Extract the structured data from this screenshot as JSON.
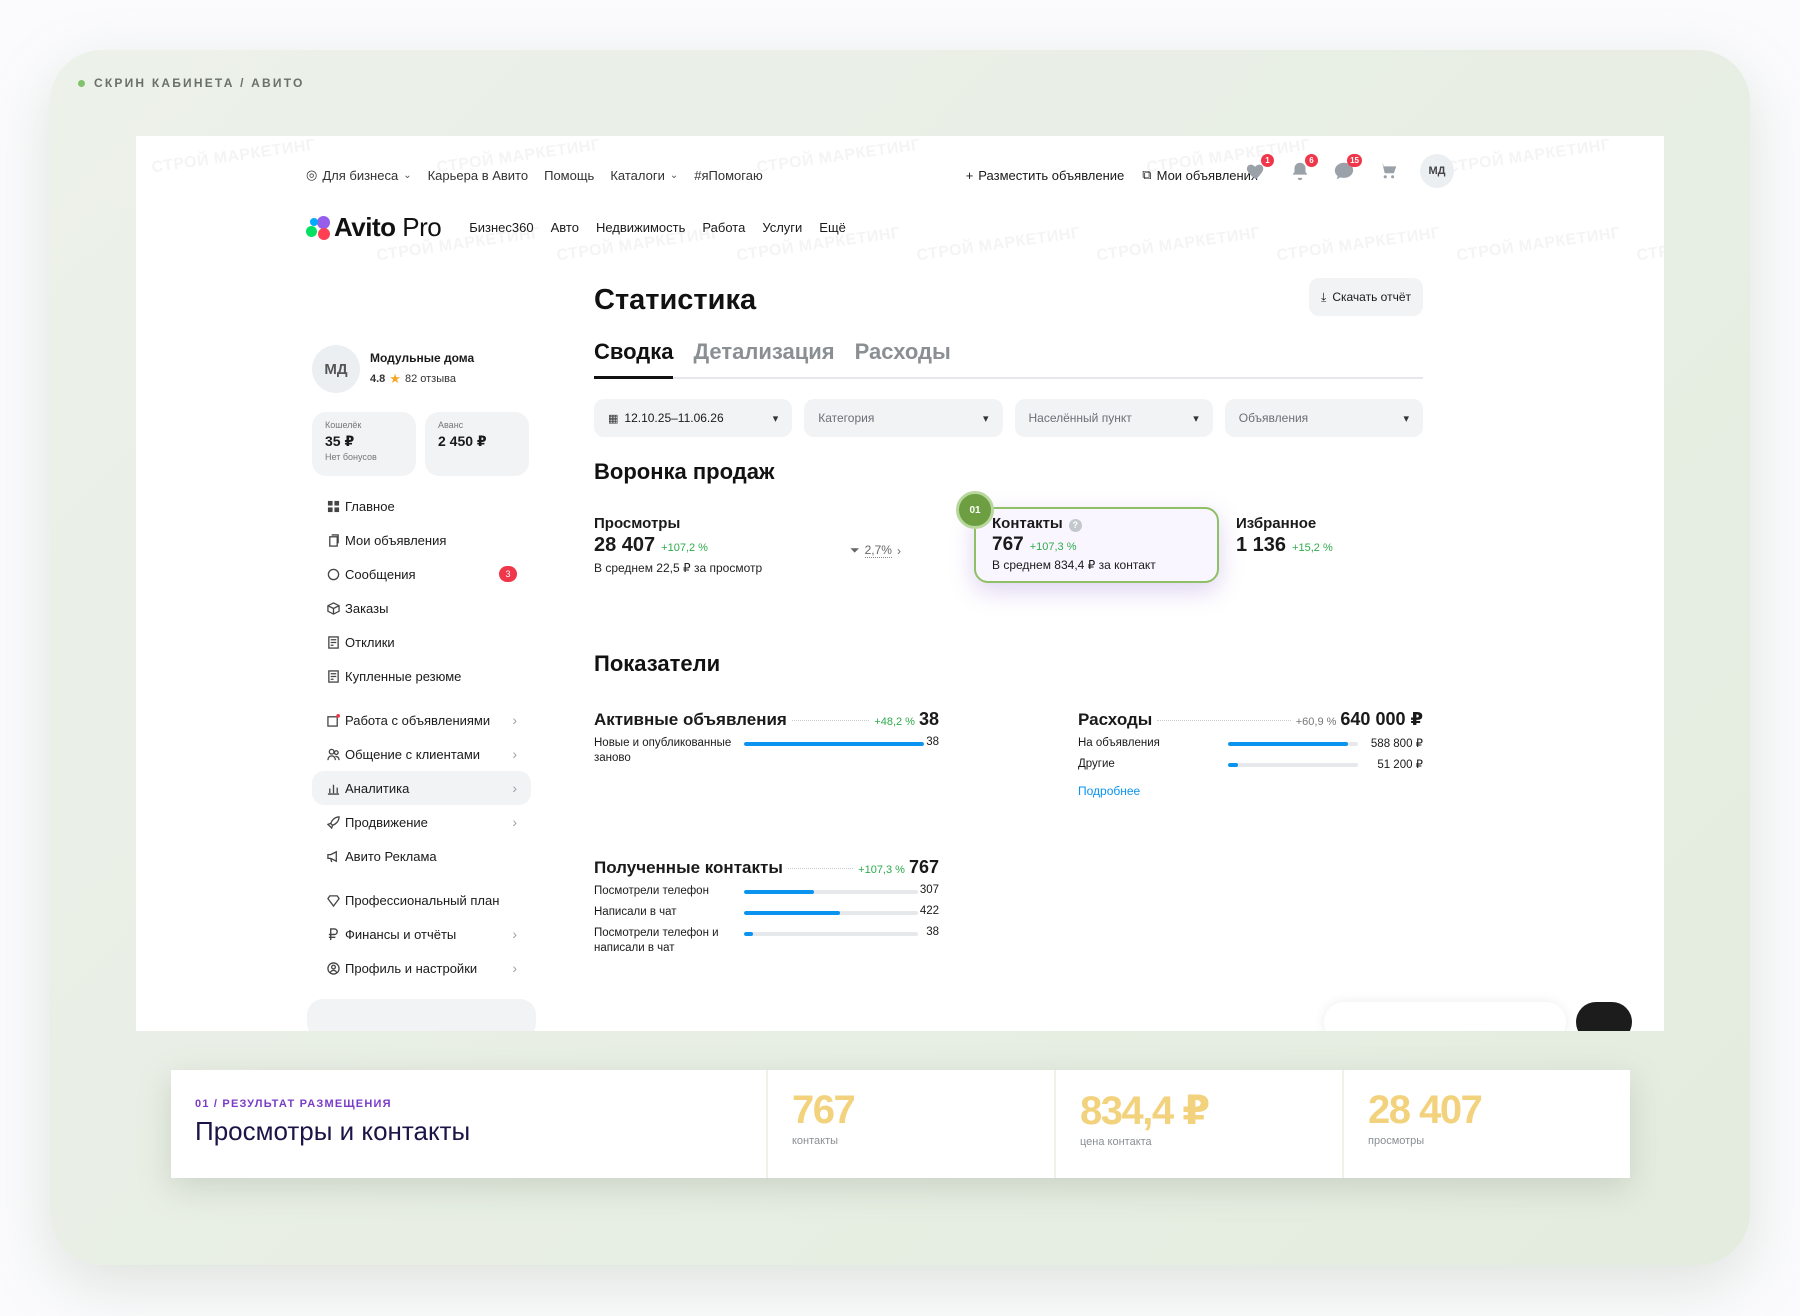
{
  "frame": {
    "label": "СКРИН КАБИНЕТА / АВИТО"
  },
  "watermark": "СТРОЙ МАРКЕТИНГ",
  "topbar": {
    "left": [
      {
        "label": "Для бизнеса",
        "dropdown": true,
        "icon": "business-icon"
      },
      {
        "label": "Карьера в Авито"
      },
      {
        "label": "Помощь"
      },
      {
        "label": "Каталоги",
        "dropdown": true
      },
      {
        "label": "#яПомогаю"
      }
    ],
    "post_ad": "Разместить объявление",
    "my_ads": "Мои объявления",
    "badges": {
      "favorites": "1",
      "notifications": "6",
      "messages": "15"
    },
    "avatar": "МД"
  },
  "nav": {
    "logo": "Avito",
    "logo_suffix": "Pro",
    "links": [
      "Бизнес360",
      "Авто",
      "Недвижимость",
      "Работа",
      "Услуги",
      "Ещё"
    ]
  },
  "profile": {
    "initials": "МД",
    "name": "Модульные дома",
    "rating": "4.8",
    "reviews": "82 отзыва"
  },
  "wallet": {
    "title": "Кошелёк",
    "value": "35 ₽",
    "sub": "Нет бонусов",
    "advance_title": "Аванс",
    "advance_value": "2 450 ₽"
  },
  "menu": [
    {
      "label": "Главное",
      "icon": "grid-icon"
    },
    {
      "label": "Мои объявления",
      "icon": "copy-icon"
    },
    {
      "label": "Сообщения",
      "icon": "chat-icon",
      "count": "3"
    },
    {
      "label": "Заказы",
      "icon": "box-icon"
    },
    {
      "label": "Отклики",
      "icon": "doc-icon"
    },
    {
      "label": "Купленные резюме",
      "icon": "doc-icon"
    },
    {
      "label": "Работа с объявлениями",
      "icon": "ads-icon",
      "arrow": true
    },
    {
      "label": "Общение с клиентами",
      "icon": "people-icon",
      "arrow": true
    },
    {
      "label": "Аналитика",
      "icon": "chart-icon",
      "arrow": true,
      "active": true
    },
    {
      "label": "Продвижение",
      "icon": "rocket-icon",
      "arrow": true
    },
    {
      "label": "Авито Реклама",
      "icon": "megaphone-icon"
    },
    {
      "label": "Профессиональный план",
      "icon": "diamond-icon"
    },
    {
      "label": "Финансы и отчёты",
      "icon": "ruble-icon",
      "arrow": true
    },
    {
      "label": "Профиль и настройки",
      "icon": "user-icon",
      "arrow": true
    }
  ],
  "main": {
    "title": "Статистика",
    "download": "Скачать отчёт",
    "tabs": [
      "Сводка",
      "Детализация",
      "Расходы"
    ],
    "filters": {
      "date": "12.10.25–11.06.26",
      "category": "Категория",
      "city": "Населённый пункт",
      "ads": "Объявления"
    },
    "funnel": {
      "title": "Воронка продаж",
      "views": {
        "label": "Просмотры",
        "value": "28 407",
        "delta": "+107,2 %",
        "avg": "В среднем 22,5 ₽ за просмотр"
      },
      "conversion": "2,7%",
      "badge": "01",
      "contacts": {
        "label": "Контакты",
        "value": "767",
        "delta": "+107,3 %",
        "avg": "В среднем 834,4 ₽ за контакт"
      },
      "favorites": {
        "label": "Избранное",
        "value": "1 136",
        "delta": "+15,2 %"
      }
    },
    "metrics": {
      "title": "Показатели",
      "active": {
        "label": "Активные объявления",
        "delta": "+48,2 %",
        "value": "38",
        "rows": [
          {
            "label": "Новые и опубликованные заново",
            "value": "38",
            "fill": 1.0
          }
        ]
      },
      "expenses": {
        "label": "Расходы",
        "delta": "+60,9 %",
        "value": "640 000 ₽",
        "rows": [
          {
            "label": "На объявления",
            "value": "588 800 ₽",
            "fill": 0.92
          },
          {
            "label": "Другие",
            "value": "51 200 ₽",
            "fill": 0.08
          }
        ],
        "more": "Подробнее"
      },
      "contacts": {
        "label": "Полученные контакты",
        "delta": "+107,3 %",
        "value": "767",
        "rows": [
          {
            "label": "Посмотрели телефон",
            "value": "307",
            "fill": 0.4
          },
          {
            "label": "Написали в чат",
            "value": "422",
            "fill": 0.55
          },
          {
            "label": "Посмотрели телефон и написали в чат",
            "value": "38",
            "fill": 0.05
          }
        ]
      }
    }
  },
  "result": {
    "caption": "01 / РЕЗУЛЬТАТ РАЗМЕЩЕНИЯ",
    "title": "Просмотры и контакты",
    "stats": [
      {
        "value": "767",
        "label": "контакты"
      },
      {
        "value": "834,4 ₽",
        "label": "цена контакта"
      },
      {
        "value": "28 407",
        "label": "просмотры"
      }
    ],
    "accent": "#f2d27c"
  },
  "colors": {
    "accent_blue": "#0a94f0",
    "positive": "#2eab4b",
    "badge_red": "#f0364a",
    "highlight_border": "#8fbf66"
  }
}
